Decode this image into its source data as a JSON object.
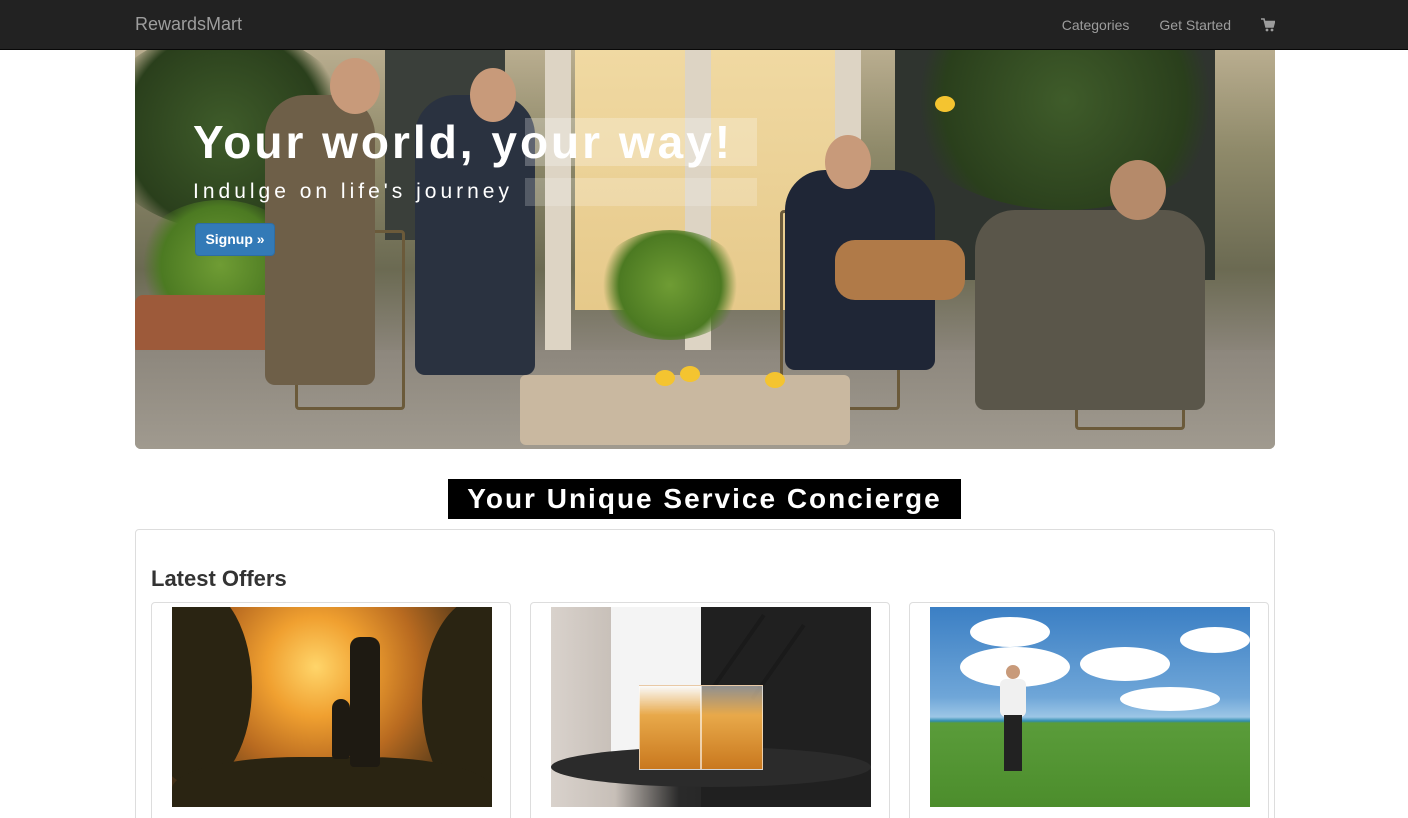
{
  "navbar": {
    "brand": "RewardsMart",
    "links": [
      "Categories",
      "Get Started"
    ],
    "cart_icon": "shopping-cart-icon"
  },
  "hero": {
    "title": "Your world, your way!",
    "subtitle": "Indulge on life's journey",
    "button_label": "Signup »",
    "image": "four men seated on a garden patio"
  },
  "concierge": {
    "label": "Your Unique Service Concierge"
  },
  "offers": {
    "heading": "Latest Offers",
    "items": [
      {
        "image": "father and child walking at sunset"
      },
      {
        "image": "waiter holding tray of cocktails"
      },
      {
        "image": "golfer swinging on seaside course"
      }
    ]
  },
  "colors": {
    "navbar_bg": "#222222",
    "nav_text": "#9d9d9d",
    "button_primary": "#337ab7",
    "banner_bg": "#000000"
  }
}
